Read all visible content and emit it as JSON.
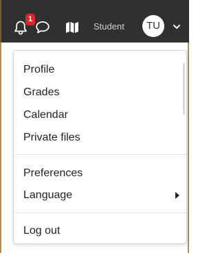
{
  "navbar": {
    "notification_count": "1",
    "user_role": "Student",
    "avatar_initials": "TU"
  },
  "user_menu": {
    "items": [
      {
        "label": "Profile"
      },
      {
        "label": "Grades"
      },
      {
        "label": "Calendar"
      },
      {
        "label": "Private files"
      }
    ],
    "items_group2": [
      {
        "label": "Preferences"
      },
      {
        "label": "Language",
        "has_submenu": true
      }
    ],
    "logout_label": "Log out"
  },
  "icons": {
    "notifications": "bell-icon",
    "messages": "chat-bubble-icon",
    "navigation": "map-icon",
    "user_menu_toggle": "chevron-down-icon",
    "submenu": "caret-right-icon"
  },
  "colors": {
    "navbar_bg": "#303030",
    "badge_bg": "#e0252a",
    "menu_text": "#1d2125"
  }
}
